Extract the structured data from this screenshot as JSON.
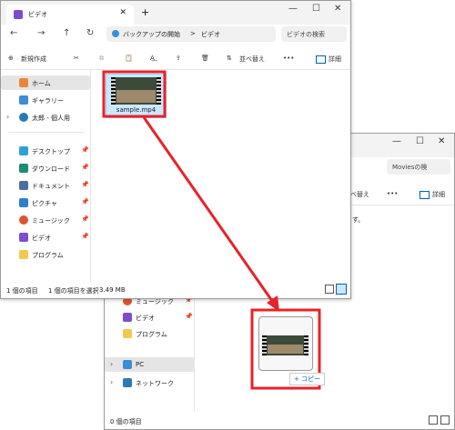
{
  "window_a": {
    "tab_title": "ビデオ",
    "breadcrumb_root": "バックアップの開始",
    "breadcrumb_sep": ">",
    "breadcrumb_current": "ビデオ",
    "search_placeholder": "ビデオの検索",
    "toolbar": {
      "new_label": "新規作成",
      "sort_label": "並べ替え",
      "more_label": "•••",
      "details_label": "詳細"
    },
    "sidebar": {
      "home": "ホーム",
      "gallery": "ギャラリー",
      "onedrive": "太郎 - 個人用",
      "desktop": "デスクトップ",
      "downloads": "ダウンロード",
      "documents": "ドキュメント",
      "pictures": "ピクチャ",
      "music": "ミュージック",
      "videos": "ビデオ",
      "programs": "プログラム"
    },
    "file": {
      "name": "sample.mp4"
    },
    "status": {
      "count": "1 個の項目",
      "selected": "1 個の項目を選択",
      "size": "3.49 MB"
    }
  },
  "window_b": {
    "search_placeholder": "Moviesの検",
    "toolbar": {
      "sort_label": "ベ替え",
      "more_label": "•••",
      "details_label": "詳細"
    },
    "sidebar": {
      "music": "ミュージック",
      "videos": "ビデオ",
      "programs": "プログラム",
      "pc": "PC",
      "network": "ネットワーク"
    },
    "status": {
      "count": "0 個の項目"
    },
    "copy_label": "+ コピー"
  },
  "colors": {
    "highlight": "#e8222a",
    "accent": "#005fb8",
    "selection": "#cce8ff"
  }
}
